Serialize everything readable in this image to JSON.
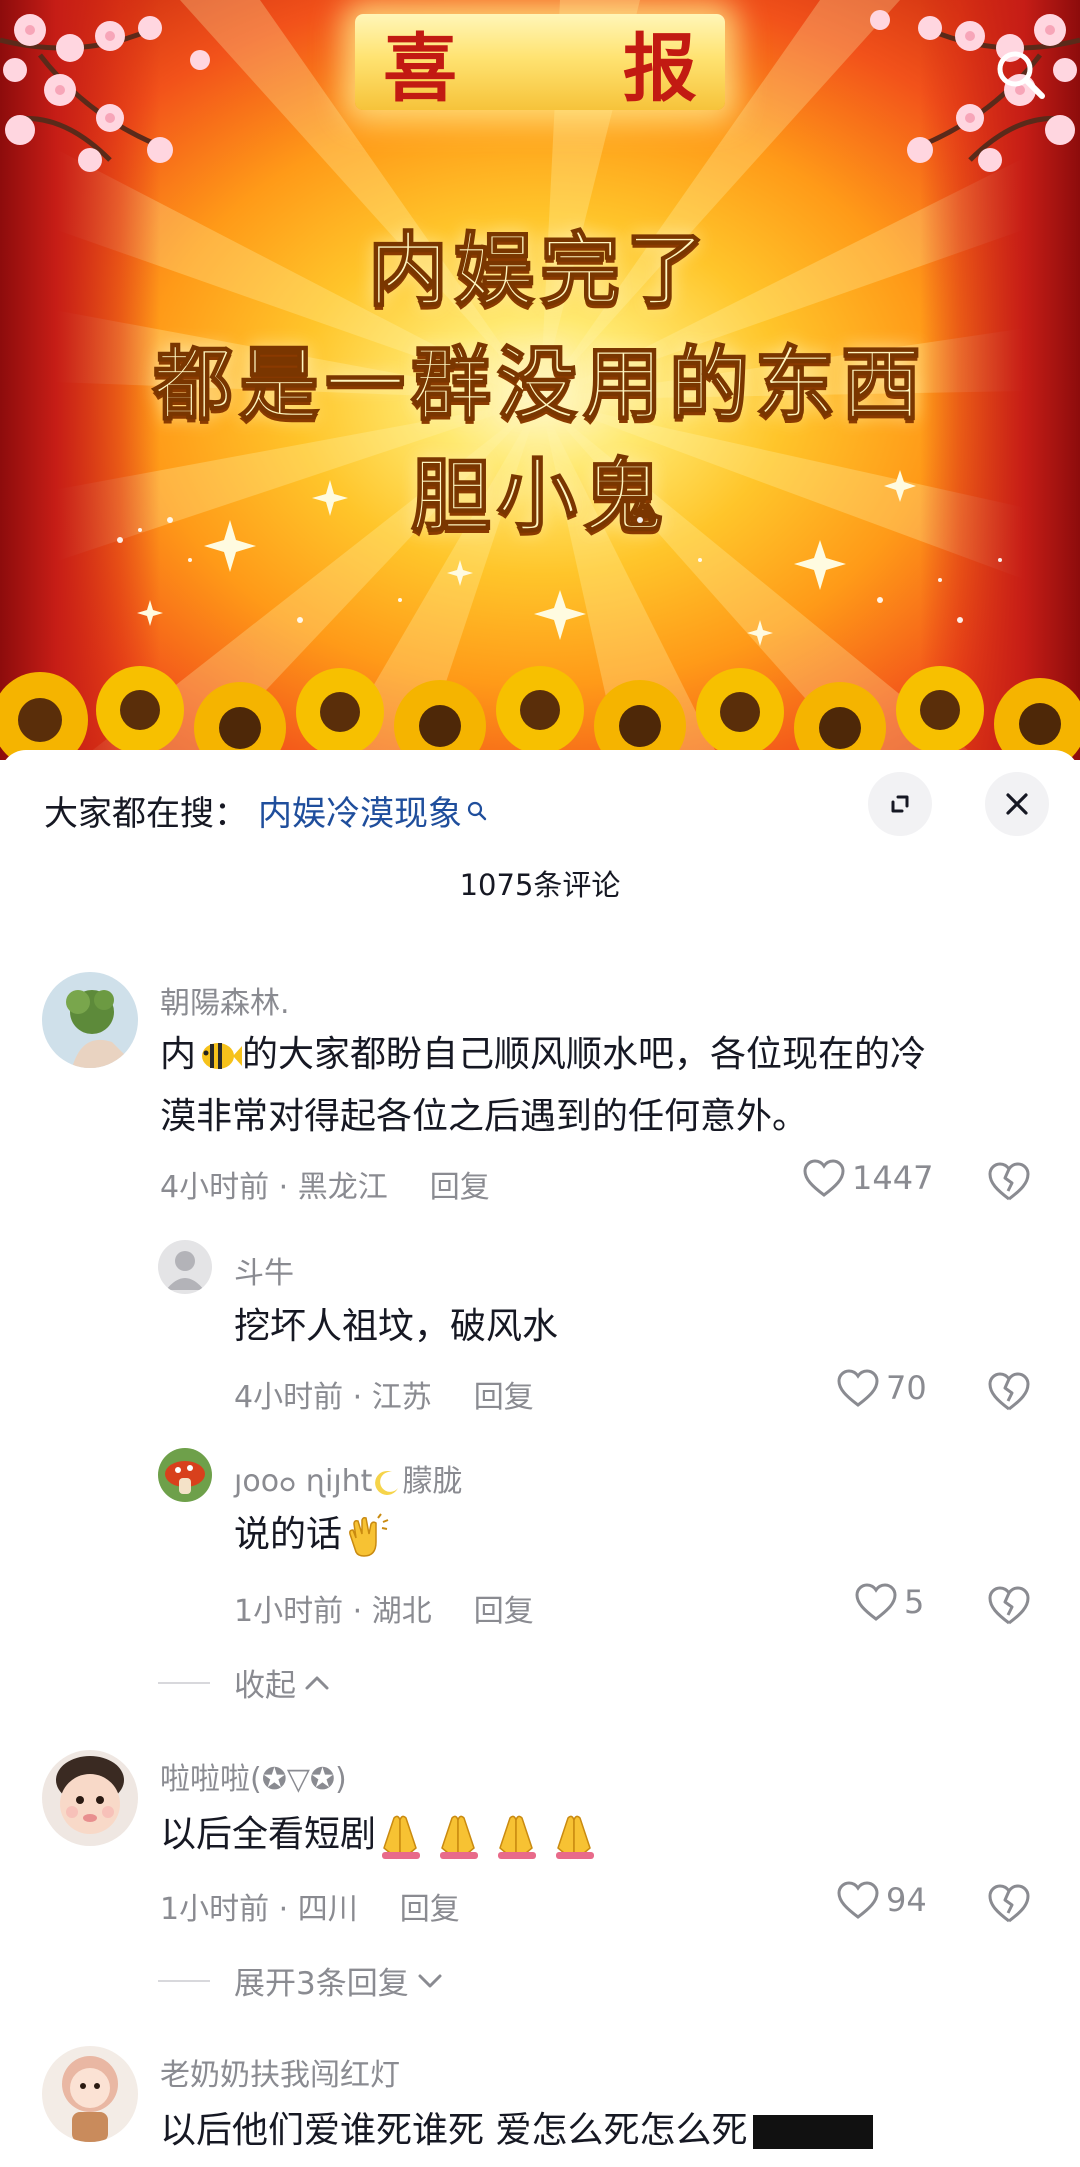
{
  "banner": {
    "title": "喜 报",
    "line1": "内娱完了",
    "line2": "都是一群没用的东西",
    "line3": "胆小鬼"
  },
  "search_hint": {
    "label": "大家都在搜：",
    "term": "内娱冷漠现象"
  },
  "comment_count": "1075条评论",
  "comments": [
    {
      "user": "朝陽森林.",
      "text_line1_a": "内",
      "text_line1_b": "的大家都盼自己顺风顺水吧，各位现在的冷",
      "text_line2": "漠非常对得起各位之后遇到的任何意外。",
      "time": "4小时前 · 黑龙江",
      "reply": "回复",
      "likes": "1447"
    },
    {
      "user": "斗牛",
      "text": "挖坏人祖坟，破风水",
      "time": "4小时前 · 江苏",
      "reply": "回复",
      "likes": "70"
    },
    {
      "user_a": "ȷooߋ ɳiȷht",
      "user_b": "朦胧",
      "text": "说的话",
      "time": "1小时前 · 湖北",
      "reply": "回复",
      "likes": "5"
    },
    {
      "user": "啦啦啦(✪▽✪)",
      "text": "以后全看短剧",
      "time": "1小时前 · 四川",
      "reply": "回复",
      "likes": "94"
    },
    {
      "user": "老奶奶扶我闯红灯",
      "text": "以后他们爱谁死谁死 爱怎么死怎么死"
    }
  ],
  "collapse_label": "收起",
  "expand_label": "展开3条回复",
  "icons": [
    "search-icon",
    "expand-icon",
    "close-icon",
    "heart-icon",
    "dislike-icon",
    "chevron-up-icon",
    "chevron-down-icon"
  ],
  "colors": {
    "link_blue": "#1f4e9c",
    "muted": "#8a8b91",
    "banner_red": "#c21a12"
  }
}
